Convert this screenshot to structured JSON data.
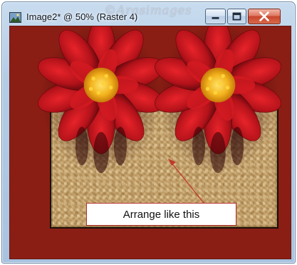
{
  "window": {
    "title": "Image2* @  50% (Raster 4)",
    "watermark": "©Arasimages",
    "buttons": {
      "minimize": "minimize-icon",
      "maximize": "maximize-icon",
      "close": "close-icon"
    }
  },
  "canvas": {
    "background_color": "#8a1e14",
    "panel_color": "#c7a268",
    "flower_petal_color": "#c0151c",
    "flower_center_color": "#f2b21c"
  },
  "annotation": {
    "label": "Arrange like this",
    "arrow_color": "#c0392b"
  }
}
